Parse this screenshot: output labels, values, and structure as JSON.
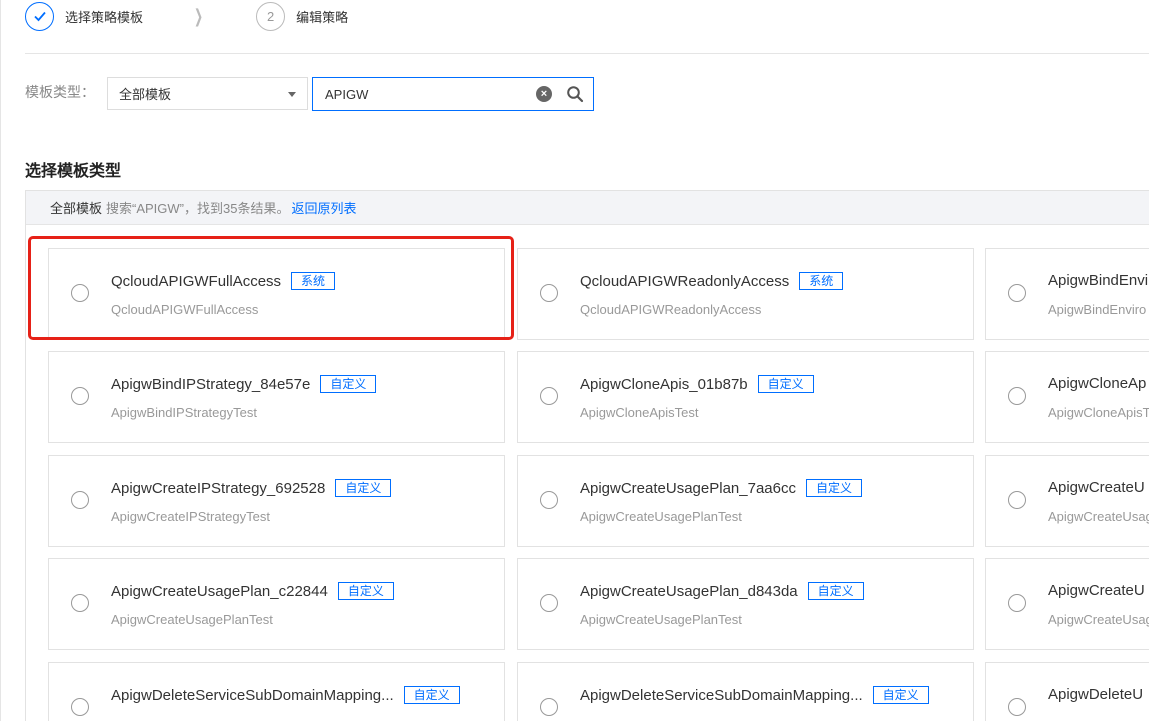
{
  "steps": [
    {
      "label": "选择策略模板",
      "state": "done",
      "icon": "check-icon"
    },
    {
      "label": "编辑策略",
      "state": "todo",
      "number": "2"
    }
  ],
  "filter": {
    "label": "模板类型：",
    "select_value": "全部模板",
    "search_value": "APIGW"
  },
  "section_title": "选择模板类型",
  "result_bar": {
    "scope": "全部模板",
    "summary": "搜索“APIGW”，找到35条结果。",
    "back_link": "返回原列表"
  },
  "highlight_color": "#e62117",
  "accent_color": "#006eff",
  "cards": [
    {
      "title": "QcloudAPIGWFullAccess",
      "badge": "系统",
      "subtitle": "QcloudAPIGWFullAccess"
    },
    {
      "title": "QcloudAPIGWReadonlyAccess",
      "badge": "系统",
      "subtitle": "QcloudAPIGWReadonlyAccess"
    },
    {
      "title": "ApigwBindEnvi",
      "badge": "",
      "subtitle": "ApigwBindEnviro"
    },
    {
      "title": "ApigwBindIPStrategy_84e57e",
      "badge": "自定义",
      "subtitle": "ApigwBindIPStrategyTest"
    },
    {
      "title": "ApigwCloneApis_01b87b",
      "badge": "自定义",
      "subtitle": "ApigwCloneApisTest"
    },
    {
      "title": "ApigwCloneAp",
      "badge": "",
      "subtitle": "ApigwCloneApisT"
    },
    {
      "title": "ApigwCreateIPStrategy_692528",
      "badge": "自定义",
      "subtitle": "ApigwCreateIPStrategyTest"
    },
    {
      "title": "ApigwCreateUsagePlan_7aa6cc",
      "badge": "自定义",
      "subtitle": "ApigwCreateUsagePlanTest"
    },
    {
      "title": "ApigwCreateU",
      "badge": "",
      "subtitle": "ApigwCreateUsag"
    },
    {
      "title": "ApigwCreateUsagePlan_c22844",
      "badge": "自定义",
      "subtitle": "ApigwCreateUsagePlanTest"
    },
    {
      "title": "ApigwCreateUsagePlan_d843da",
      "badge": "自定义",
      "subtitle": "ApigwCreateUsagePlanTest"
    },
    {
      "title": "ApigwCreateU",
      "badge": "",
      "subtitle": "ApigwCreateUsag"
    },
    {
      "title": "ApigwDeleteServiceSubDomainMapping...",
      "badge": "自定义",
      "subtitle": ""
    },
    {
      "title": "ApigwDeleteServiceSubDomainMapping...",
      "badge": "自定义",
      "subtitle": ""
    },
    {
      "title": "ApigwDeleteU",
      "badge": "",
      "subtitle": ""
    }
  ]
}
